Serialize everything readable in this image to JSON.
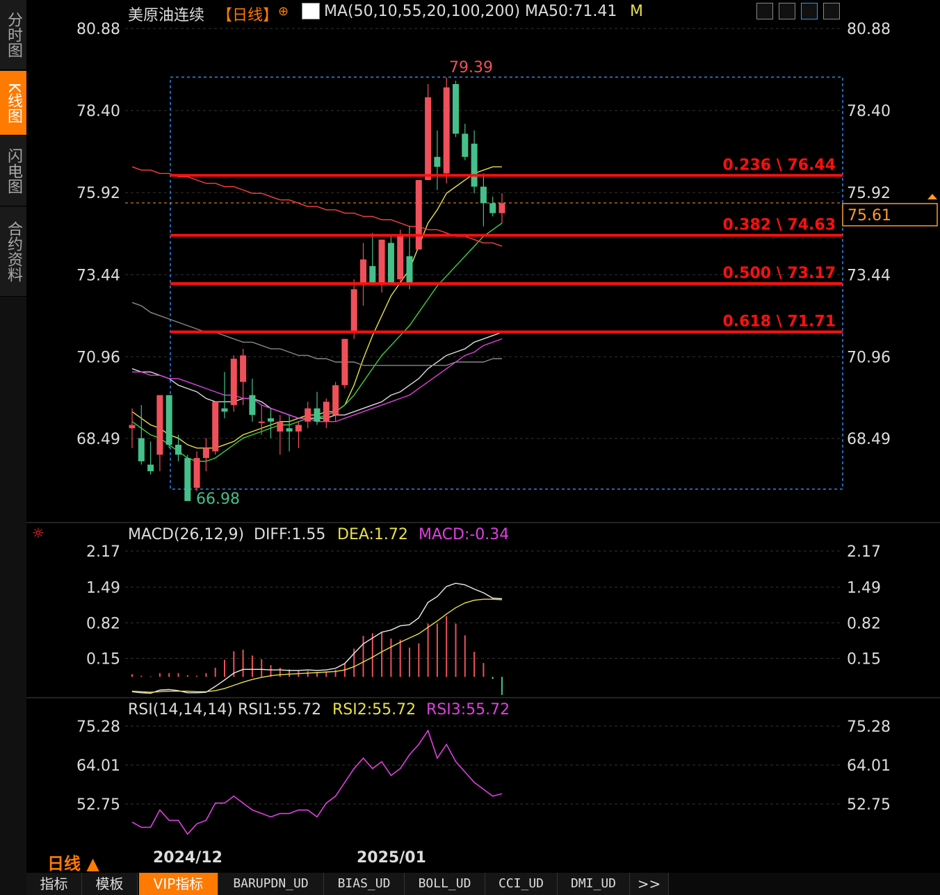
{
  "nav": {
    "items": [
      {
        "label": "分时图"
      },
      {
        "label": "K线图"
      },
      {
        "label": "闪电图"
      },
      {
        "label": "合约资料"
      }
    ]
  },
  "header": {
    "instrument": "美原油连续",
    "period_tag": "【日线】",
    "ma_label": "MA(50,10,55,20,100,200)",
    "ma_value": "MA50:71.41",
    "ma_suffix": "M"
  },
  "price_panel": {
    "ticks": [
      "80.88",
      "78.40",
      "75.92",
      "73.44",
      "70.96",
      "68.49"
    ],
    "current_price": "75.61",
    "high_label": "79.39",
    "low_label": "66.98",
    "fib_levels": [
      "0.236 \\ 76.44",
      "0.382 \\ 74.63",
      "0.500 \\ 73.17",
      "0.618 \\ 71.71"
    ]
  },
  "macd_panel": {
    "title": "MACD(26,12,9)",
    "diff": "DIFF:1.55",
    "dea": "DEA:1.72",
    "macd": "MACD:-0.34",
    "ticks": [
      "2.17",
      "1.49",
      "0.82",
      "0.15"
    ]
  },
  "rsi_panel": {
    "title": "RSI(14,14,14)",
    "rsi1": "RSI1:55.72",
    "rsi2": "RSI2:55.72",
    "rsi3": "RSI3:55.72",
    "ticks": [
      "75.28",
      "64.01",
      "52.75"
    ]
  },
  "x_axis": {
    "labels": [
      "2024/12",
      "2025/01"
    ]
  },
  "period_selector": "日线 ▲",
  "bottom_tabs": [
    "指标",
    "模板",
    "VIP指标",
    "BARUPDN_UD",
    "BIAS_UD",
    "BOLL_UD",
    "CCI_UD",
    "DMI_UD",
    ">>"
  ],
  "colors": {
    "up": "#f0505a",
    "down": "#45c08a",
    "fib": "#ff1010",
    "accent": "#ff7a00",
    "ma_yellow": "#e8e04a",
    "ma_white": "#dddddd",
    "ma_green": "#3fd13f",
    "ma_magenta": "#e040e0",
    "ma_red": "#ff4040",
    "ma_gray": "#888888"
  },
  "chart_data": {
    "type": "candlestick",
    "candles": [
      {
        "o": 68.8,
        "h": 69.4,
        "l": 68.2,
        "c": 68.9
      },
      {
        "o": 68.5,
        "h": 69.5,
        "l": 67.7,
        "c": 67.8
      },
      {
        "o": 67.7,
        "h": 68.4,
        "l": 67.4,
        "c": 67.5
      },
      {
        "o": 68.0,
        "h": 69.8,
        "l": 67.5,
        "c": 69.8
      },
      {
        "o": 69.8,
        "h": 69.8,
        "l": 68.2,
        "c": 68.3
      },
      {
        "o": 68.3,
        "h": 68.6,
        "l": 67.8,
        "c": 68.0
      },
      {
        "o": 67.9,
        "h": 68.0,
        "l": 66.9,
        "c": 66.6
      },
      {
        "o": 67.0,
        "h": 68.1,
        "l": 66.9,
        "c": 67.9
      },
      {
        "o": 67.9,
        "h": 68.5,
        "l": 67.5,
        "c": 68.2
      },
      {
        "o": 68.1,
        "h": 69.6,
        "l": 68.0,
        "c": 69.6
      },
      {
        "o": 69.4,
        "h": 70.5,
        "l": 69.1,
        "c": 69.3
      },
      {
        "o": 69.5,
        "h": 71.0,
        "l": 69.3,
        "c": 70.9
      },
      {
        "o": 70.2,
        "h": 71.2,
        "l": 69.5,
        "c": 71.0
      },
      {
        "o": 69.8,
        "h": 70.3,
        "l": 69.0,
        "c": 69.2
      },
      {
        "o": 69.0,
        "h": 69.5,
        "l": 68.6,
        "c": 69.0
      },
      {
        "o": 69.1,
        "h": 69.4,
        "l": 68.5,
        "c": 69.0
      },
      {
        "o": 68.7,
        "h": 69.2,
        "l": 68.0,
        "c": 69.0
      },
      {
        "o": 68.8,
        "h": 69.2,
        "l": 68.1,
        "c": 68.7
      },
      {
        "o": 68.7,
        "h": 69.0,
        "l": 68.2,
        "c": 68.9
      },
      {
        "o": 69.0,
        "h": 69.6,
        "l": 68.8,
        "c": 69.4
      },
      {
        "o": 69.4,
        "h": 69.9,
        "l": 68.9,
        "c": 69.0
      },
      {
        "o": 69.0,
        "h": 69.7,
        "l": 68.8,
        "c": 69.6
      },
      {
        "o": 69.2,
        "h": 70.2,
        "l": 69.0,
        "c": 70.1
      },
      {
        "o": 70.1,
        "h": 71.5,
        "l": 70.0,
        "c": 71.5
      },
      {
        "o": 71.7,
        "h": 73.3,
        "l": 71.5,
        "c": 73.0
      },
      {
        "o": 73.2,
        "h": 74.4,
        "l": 72.5,
        "c": 73.9
      },
      {
        "o": 73.7,
        "h": 74.7,
        "l": 73.2,
        "c": 73.2
      },
      {
        "o": 73.2,
        "h": 74.5,
        "l": 72.9,
        "c": 74.5
      },
      {
        "o": 74.4,
        "h": 74.6,
        "l": 73.2,
        "c": 73.2
      },
      {
        "o": 73.3,
        "h": 74.8,
        "l": 73.2,
        "c": 74.6
      },
      {
        "o": 74.0,
        "h": 74.9,
        "l": 73.0,
        "c": 73.2
      },
      {
        "o": 74.2,
        "h": 76.3,
        "l": 74.2,
        "c": 76.3
      },
      {
        "o": 76.3,
        "h": 79.2,
        "l": 76.3,
        "c": 78.8
      },
      {
        "o": 77.0,
        "h": 77.8,
        "l": 76.0,
        "c": 76.7
      },
      {
        "o": 76.5,
        "h": 79.4,
        "l": 76.2,
        "c": 79.1
      },
      {
        "o": 79.2,
        "h": 79.3,
        "l": 77.6,
        "c": 77.7
      },
      {
        "o": 77.7,
        "h": 78.0,
        "l": 76.9,
        "c": 77.0
      },
      {
        "o": 77.4,
        "h": 77.8,
        "l": 75.9,
        "c": 76.1
      },
      {
        "o": 76.1,
        "h": 76.5,
        "l": 74.9,
        "c": 75.6
      },
      {
        "o": 75.6,
        "h": 75.8,
        "l": 75.2,
        "c": 75.3
      },
      {
        "o": 75.3,
        "h": 75.9,
        "l": 75.0,
        "c": 75.6
      }
    ],
    "ma_series": [
      {
        "name": "MA50",
        "values": [
          69.3,
          69.1,
          68.9,
          68.8,
          68.6,
          68.5,
          68.3,
          68.2,
          68.2,
          68.2,
          68.3,
          68.4,
          68.6,
          68.7,
          68.8,
          68.9,
          69.0,
          69.0,
          69.1,
          69.2,
          69.2,
          69.3,
          69.3,
          69.5,
          70.1,
          70.9,
          71.6,
          72.2,
          72.8,
          73.2,
          73.6,
          74.3,
          75.0,
          75.4,
          75.9,
          76.1,
          76.3,
          76.5,
          76.6,
          76.7,
          76.7
        ]
      },
      {
        "name": "MA55",
        "values": [
          69.0,
          68.8,
          68.6,
          68.5,
          68.3,
          68.1,
          67.9,
          67.8,
          67.8,
          67.9,
          68.1,
          68.3,
          68.5,
          68.6,
          68.7,
          68.8,
          68.9,
          68.9,
          69.0,
          69.1,
          69.1,
          69.2,
          69.3,
          69.5,
          69.8,
          70.2,
          70.6,
          71.0,
          71.3,
          71.6,
          71.9,
          72.3,
          72.7,
          73.1,
          73.4,
          73.7,
          74.0,
          74.3,
          74.6,
          74.8,
          75.0
        ]
      },
      {
        "name": "MA10",
        "values": [
          70.6,
          70.5,
          70.5,
          70.4,
          70.3,
          70.1,
          70.0,
          69.9,
          69.7,
          69.6,
          69.6,
          69.6,
          69.7,
          69.7,
          69.6,
          69.4,
          69.3,
          69.2,
          69.1,
          69.1,
          69.1,
          69.1,
          69.2,
          69.2,
          69.3,
          69.4,
          69.5,
          69.6,
          69.8,
          69.9,
          70.1,
          70.3,
          70.6,
          70.8,
          71.0,
          71.1,
          71.2,
          71.4,
          71.5,
          71.6,
          71.7
        ]
      },
      {
        "name": "MA20",
        "values": [
          70.5,
          70.5,
          70.4,
          70.4,
          70.3,
          70.3,
          70.2,
          70.1,
          70.0,
          69.9,
          69.8,
          69.8,
          69.7,
          69.7,
          69.5,
          69.4,
          69.3,
          69.2,
          69.1,
          69.1,
          69.0,
          69.0,
          69.0,
          69.1,
          69.2,
          69.3,
          69.4,
          69.5,
          69.6,
          69.7,
          69.8,
          70.0,
          70.2,
          70.4,
          70.6,
          70.8,
          71.0,
          71.1,
          71.3,
          71.4,
          71.5
        ]
      },
      {
        "name": "MA100",
        "values": [
          76.7,
          76.6,
          76.6,
          76.5,
          76.5,
          76.4,
          76.4,
          76.3,
          76.2,
          76.2,
          76.1,
          76.1,
          76.0,
          75.9,
          75.9,
          75.8,
          75.7,
          75.7,
          75.6,
          75.5,
          75.5,
          75.4,
          75.4,
          75.3,
          75.3,
          75.2,
          75.2,
          75.1,
          75.1,
          75.0,
          74.9,
          74.9,
          74.8,
          74.8,
          74.7,
          74.6,
          74.6,
          74.5,
          74.4,
          74.4,
          74.3
        ]
      },
      {
        "name": "MA200",
        "values": [
          72.6,
          72.5,
          72.3,
          72.2,
          72.1,
          72.0,
          71.9,
          71.8,
          71.7,
          71.7,
          71.6,
          71.5,
          71.4,
          71.4,
          71.3,
          71.2,
          71.2,
          71.1,
          71.0,
          71.0,
          70.9,
          70.9,
          70.8,
          70.8,
          70.8,
          70.7,
          70.7,
          70.7,
          70.7,
          70.7,
          70.7,
          70.7,
          70.7,
          70.7,
          70.7,
          70.8,
          70.8,
          70.8,
          70.8,
          70.9,
          70.9
        ]
      }
    ],
    "macd": {
      "diff": [
        -0.28,
        -0.3,
        -0.31,
        -0.25,
        -0.24,
        -0.26,
        -0.3,
        -0.3,
        -0.29,
        -0.18,
        -0.06,
        0.07,
        0.14,
        0.14,
        0.14,
        0.13,
        0.13,
        0.12,
        0.12,
        0.13,
        0.12,
        0.13,
        0.16,
        0.25,
        0.44,
        0.62,
        0.73,
        0.84,
        0.88,
        0.96,
        0.98,
        1.11,
        1.4,
        1.51,
        1.7,
        1.76,
        1.73,
        1.65,
        1.58,
        1.48,
        1.47
      ],
      "dea": [
        -0.27,
        -0.28,
        -0.29,
        -0.28,
        -0.27,
        -0.27,
        -0.27,
        -0.28,
        -0.28,
        -0.26,
        -0.22,
        -0.16,
        -0.1,
        -0.05,
        -0.01,
        0.02,
        0.04,
        0.05,
        0.06,
        0.07,
        0.08,
        0.09,
        0.1,
        0.13,
        0.19,
        0.28,
        0.37,
        0.47,
        0.56,
        0.65,
        0.73,
        0.81,
        0.93,
        1.05,
        1.18,
        1.3,
        1.39,
        1.44,
        1.46,
        1.46,
        1.45
      ],
      "hist": [
        0.05,
        0.02,
        0.01,
        0.07,
        0.07,
        0.07,
        0.03,
        0.02,
        0.07,
        0.17,
        0.32,
        0.48,
        0.51,
        0.4,
        0.33,
        0.22,
        0.17,
        0.14,
        0.12,
        0.11,
        0.09,
        0.1,
        0.13,
        0.25,
        0.53,
        0.77,
        0.82,
        0.85,
        0.72,
        0.7,
        0.55,
        0.63,
        1.0,
        1.0,
        1.14,
        1.0,
        0.78,
        0.47,
        0.26,
        -0.04,
        -0.34
      ]
    },
    "rsi": [
      47.5,
      46,
      46,
      51,
      48,
      48,
      44,
      47,
      48,
      53,
      53,
      55,
      53,
      51,
      50,
      49,
      50,
      50,
      51,
      51,
      49,
      53,
      55,
      59,
      63,
      66,
      63,
      65,
      61,
      63,
      67,
      70,
      74,
      66,
      70,
      65,
      62,
      59,
      57,
      55,
      55.72
    ]
  }
}
